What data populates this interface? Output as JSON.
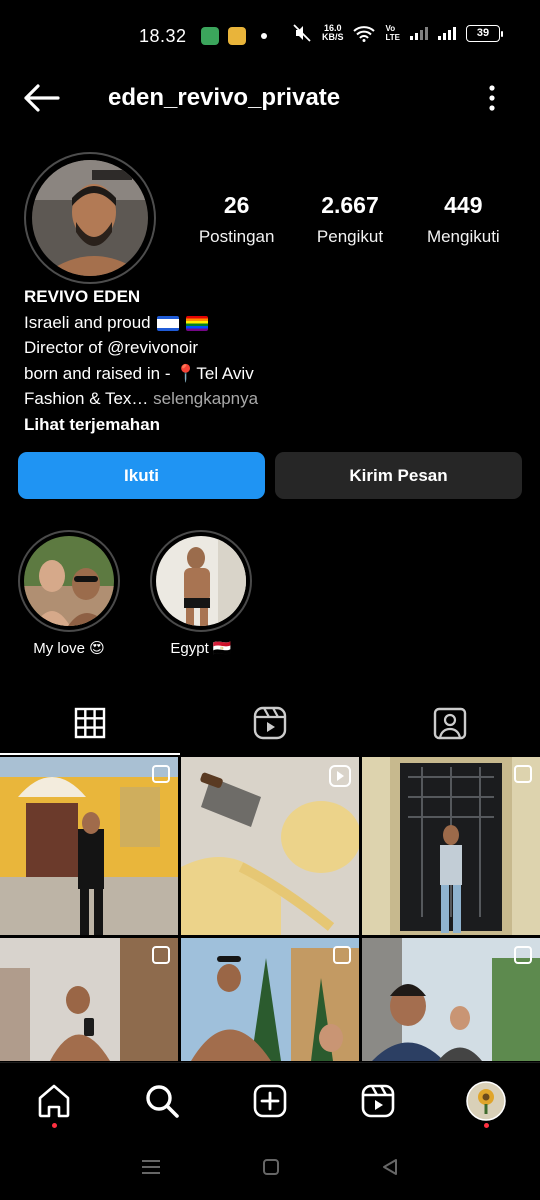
{
  "status_bar": {
    "time": "18.32",
    "speed_value": "16.0",
    "speed_unit": "KB/S",
    "network_tag_top": "Vo",
    "network_tag_bottom": "LTE",
    "battery": "39"
  },
  "header": {
    "username": "eden_revivo_private",
    "back_icon": "arrow-left-icon",
    "more_icon": "more-vertical-icon"
  },
  "profile": {
    "stats": [
      {
        "value": "26",
        "label": "Postingan"
      },
      {
        "value": "2.667",
        "label": "Pengikut"
      },
      {
        "value": "449",
        "label": "Mengikuti"
      }
    ],
    "bio": {
      "name": "REVIVO EDEN",
      "line1": "Israeli and proud",
      "line2": "Director of @revivonoir",
      "line3_prefix": "born and raised in - ",
      "line3_place": "Tel Aviv",
      "line4": "Fashion & Tex…",
      "more": " selengkapnya",
      "translate": "Lihat terjemahan"
    }
  },
  "actions": {
    "follow_label": "Ikuti",
    "message_label": "Kirim Pesan",
    "follow_color": "#1f94f3",
    "message_color": "#262626"
  },
  "highlights": [
    {
      "label": "My love 😍"
    },
    {
      "label": "Egypt 🇪🇬"
    }
  ],
  "tabs": [
    {
      "icon": "grid-icon",
      "active": true
    },
    {
      "icon": "reels-icon",
      "active": false
    },
    {
      "icon": "tagged-icon",
      "active": false
    }
  ],
  "bottom_nav": [
    {
      "icon": "home-icon"
    },
    {
      "icon": "search-icon"
    },
    {
      "icon": "create-post-icon"
    },
    {
      "icon": "reels-icon"
    },
    {
      "icon": "profile-avatar-icon"
    }
  ],
  "system_nav": [
    {
      "icon": "recent-apps-icon"
    },
    {
      "icon": "home-circle-icon"
    },
    {
      "icon": "back-triangle-icon"
    }
  ]
}
